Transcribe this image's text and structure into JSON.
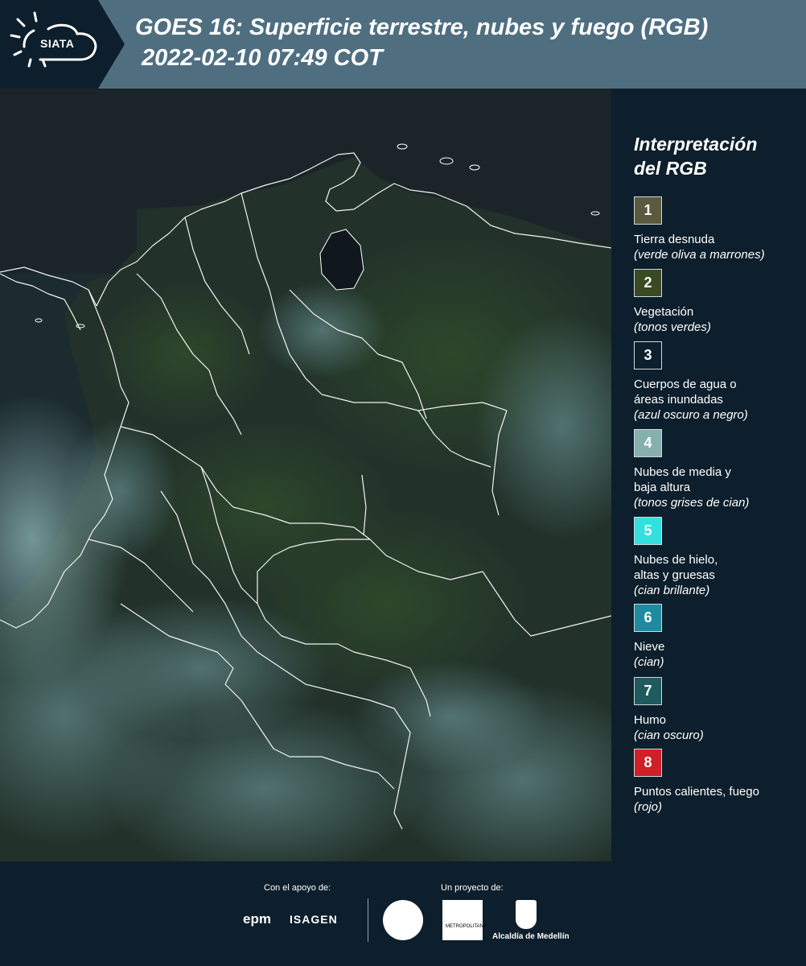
{
  "header": {
    "logo_text": "SIATA",
    "title": "GOES 16: Superficie terrestre, nubes y fuego (RGB)",
    "subtitle": "2022-02-10 07:49 COT"
  },
  "legend": {
    "title_line1": "Interpretación",
    "title_line2": "del RGB",
    "items": [
      {
        "number": "1",
        "color": "#5b5a3f",
        "label1": "Tierra desnuda",
        "label2": "",
        "note": "(verde oliva a marrones)"
      },
      {
        "number": "2",
        "color": "#3a4a23",
        "label1": "Vegetación",
        "label2": "",
        "note": "(tonos verdes)"
      },
      {
        "number": "3",
        "color": "#0d1f2c",
        "label1": "Cuerpos de agua o",
        "label2": "áreas inundadas",
        "note": "(azul oscuro a negro)"
      },
      {
        "number": "4",
        "color": "#86b0ae",
        "label1": "Nubes de media y",
        "label2": "baja altura",
        "note": "(tonos grises de cian)"
      },
      {
        "number": "5",
        "color": "#33e0df",
        "label1": "Nubes de hielo,",
        "label2": "altas y gruesas",
        "note": "(cian brillante)"
      },
      {
        "number": "6",
        "color": "#1f8ba0",
        "label1": "Nieve",
        "label2": "",
        "note": "(cian)"
      },
      {
        "number": "7",
        "color": "#1f5a5f",
        "label1": "Humo",
        "label2": "",
        "note": "(cian oscuro)"
      },
      {
        "number": "8",
        "color": "#cf2027",
        "label1": "Puntos calientes, fuego",
        "label2": "",
        "note": "(rojo)"
      }
    ]
  },
  "footer": {
    "support_label": "Con el apoyo de:",
    "project_label": "Un proyecto de:",
    "epm": "epm",
    "isagen": "ISAGEN",
    "area_text": "METROPOLITANA",
    "medellin": "Alcaldía de Medellín"
  }
}
